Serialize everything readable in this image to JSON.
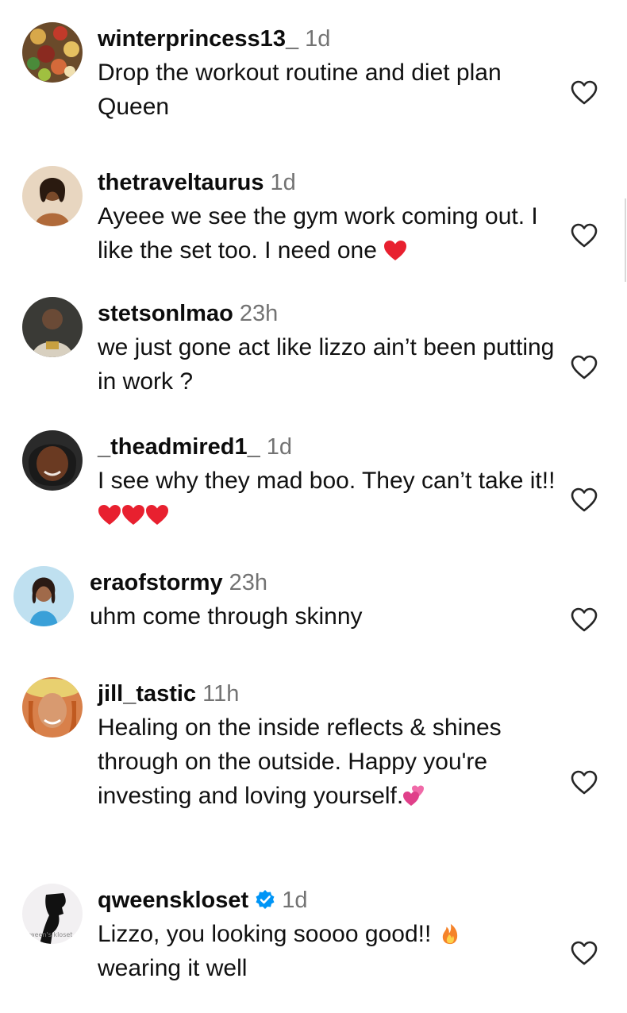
{
  "comments": [
    {
      "username": "winterprincess13_",
      "time": "1d",
      "text": "Drop the workout routine and diet plan Queen"
    },
    {
      "username": "thetraveltaurus",
      "time": "1d",
      "text": "Ayeee we see the gym work coming out. I like the set too. I need one",
      "emoji": "red-heart"
    },
    {
      "username": "stetsonlmao",
      "time": "23h",
      "text": "we just gone act like lizzo ain’t been putting in work ?"
    },
    {
      "username": "_theadmired1_",
      "time": "1d",
      "text": "I see why they mad boo. They can’t take it!!",
      "emoji": "red-heart x3"
    },
    {
      "username": "eraofstormy",
      "time": "23h",
      "text": "uhm come through skinny"
    },
    {
      "username": "jill_tastic",
      "time": "11h",
      "text": "Healing on the inside reflects & shines through on the outside. Happy you're investing and loving yourself.",
      "emoji": "two-hearts"
    },
    {
      "username": "qweenskloset",
      "time": "1d",
      "verified": true,
      "text": "Lizzo, you looking soooo good!!",
      "text2": "wearing it well",
      "emoji": "fire"
    }
  ],
  "icons": {
    "like": "heart-outline-icon",
    "verified": "verified-badge-icon"
  },
  "colors": {
    "text": "#0c0c0c",
    "muted": "#737373",
    "heart_red": "#e8202f",
    "verified_blue": "#0095f6"
  }
}
